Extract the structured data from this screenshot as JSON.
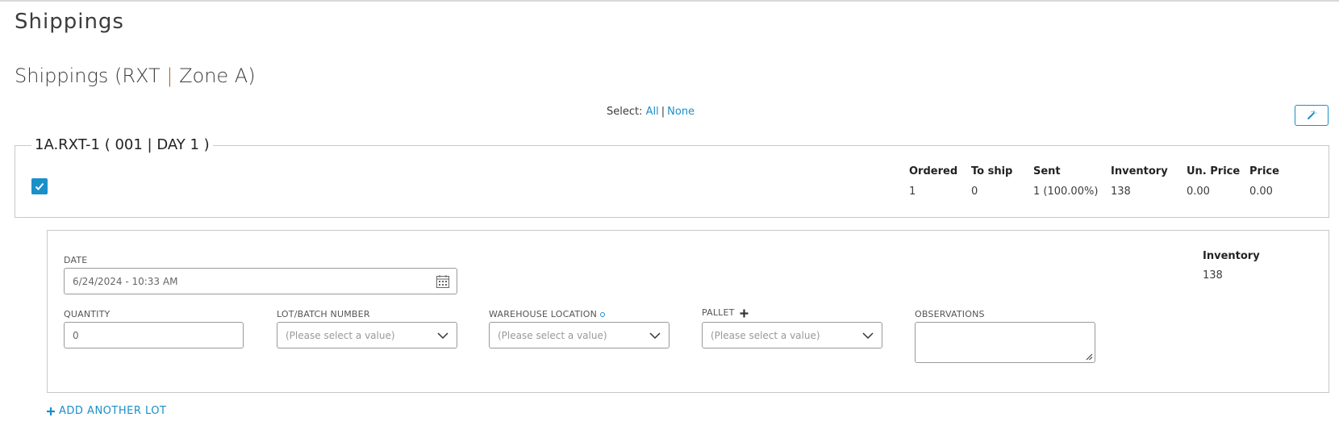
{
  "page": {
    "title": "Shippings"
  },
  "section": {
    "prefix": "Shippings (RXT ",
    "separator": "|",
    "suffix": " Zone A)"
  },
  "select": {
    "label": "Select:",
    "all": "All",
    "divider": "|",
    "none": "None"
  },
  "item": {
    "legend": "1A.RXT-1 ( 001 | DAY 1 )",
    "checked": true,
    "stats": [
      {
        "header": "Ordered",
        "value": "1"
      },
      {
        "header": "To ship",
        "value": "0"
      },
      {
        "header": "Sent",
        "value": "1 (100.00%)"
      },
      {
        "header": "Inventory",
        "value": "138"
      },
      {
        "header": "Un. Price",
        "value": "0.00"
      },
      {
        "header": "Price",
        "value": "0.00"
      }
    ]
  },
  "lot": {
    "date_label": "DATE",
    "date_value": "6/24/2024 - 10:33 AM",
    "quantity_label": "QUANTITY",
    "quantity_value": "0",
    "lot_label": "LOT/BATCH NUMBER",
    "lot_placeholder": "(Please select a value)",
    "warehouse_label": "WAREHOUSE LOCATION",
    "warehouse_placeholder": "(Please select a value)",
    "pallet_label": "PALLET",
    "pallet_placeholder": "(Please select a value)",
    "observations_label": "OBSERVATIONS",
    "observations_value": "",
    "inventory_label": "Inventory",
    "inventory_value": "138"
  },
  "actions": {
    "add_lot": "ADD ANOTHER LOT"
  },
  "icons": {
    "settings": "wand-icon",
    "calendar": "calendar-icon",
    "check": "check-icon",
    "chevron": "chevron-down-icon",
    "plus": "plus-icon",
    "required": "required-dot-icon"
  },
  "colors": {
    "accent": "#1a8fc9",
    "separator": "#b5651d",
    "border": "#c8c8c8"
  }
}
